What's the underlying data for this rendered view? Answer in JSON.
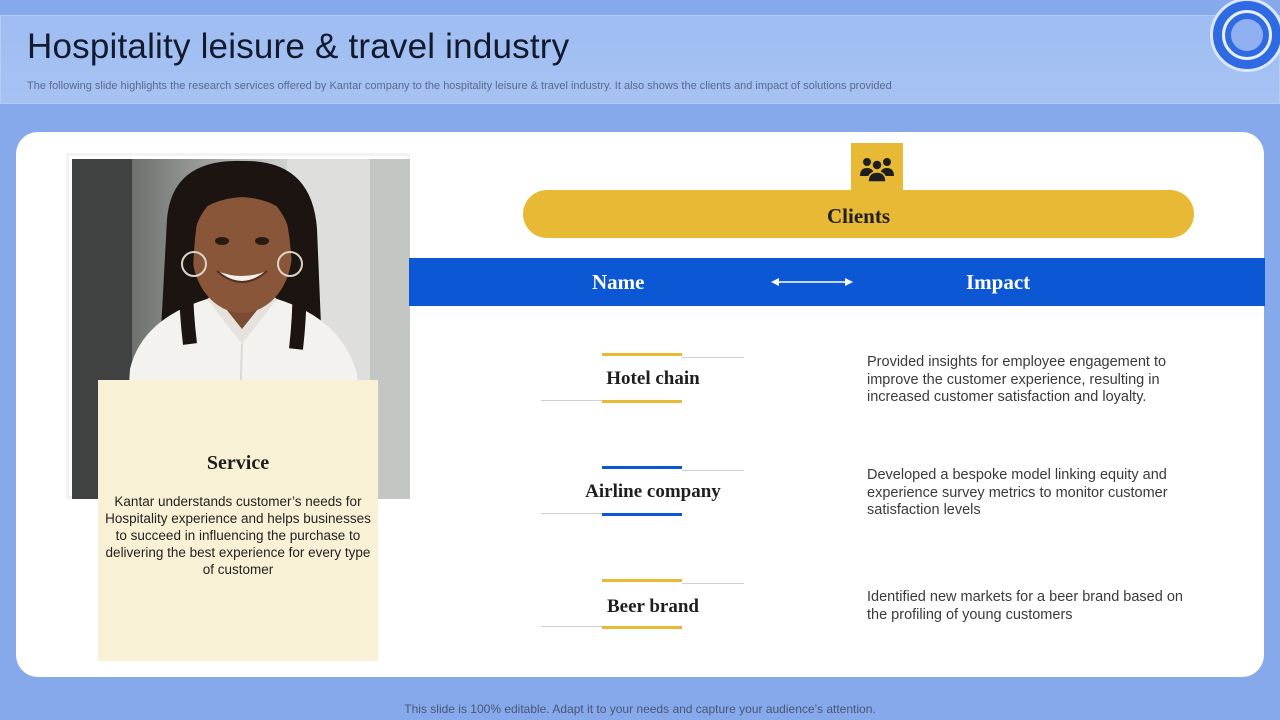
{
  "header": {
    "title": "Hospitality leisure & travel industry",
    "subtitle": "The following slide highlights the research services offered by Kantar company to the hospitality leisure & travel industry. It also shows the clients and impact of solutions provided"
  },
  "service": {
    "title": "Service",
    "text": "Kantar understands customer’s needs for Hospitality experience and helps businesses to succeed in influencing the purchase to delivering the best experience for every type of customer"
  },
  "clients": {
    "icon": "users-group-icon",
    "title": "Clients",
    "name_header": "Name",
    "impact_header": "Impact",
    "rows": [
      {
        "name": "Hotel chain",
        "impact": "Provided insights for employee engagement to improve the customer experience, resulting in increased customer satisfaction and loyalty.",
        "accent": "#e8b935"
      },
      {
        "name": "Airline company",
        "impact": "Developed a bespoke model linking equity and experience survey metrics to monitor customer satisfaction levels",
        "accent": "#0c57d4"
      },
      {
        "name": "Beer brand",
        "impact": "Identified new markets for a beer brand based on the profiling of young customers",
        "accent": "#e8b935"
      }
    ]
  },
  "colors": {
    "background": "#86a9ec",
    "yellow": "#e8b935",
    "blue": "#0c57d4",
    "service_bg": "#f9f1d5"
  },
  "footer": {
    "text": "This slide is 100% editable. Adapt it to your needs and capture your audience’s attention."
  }
}
